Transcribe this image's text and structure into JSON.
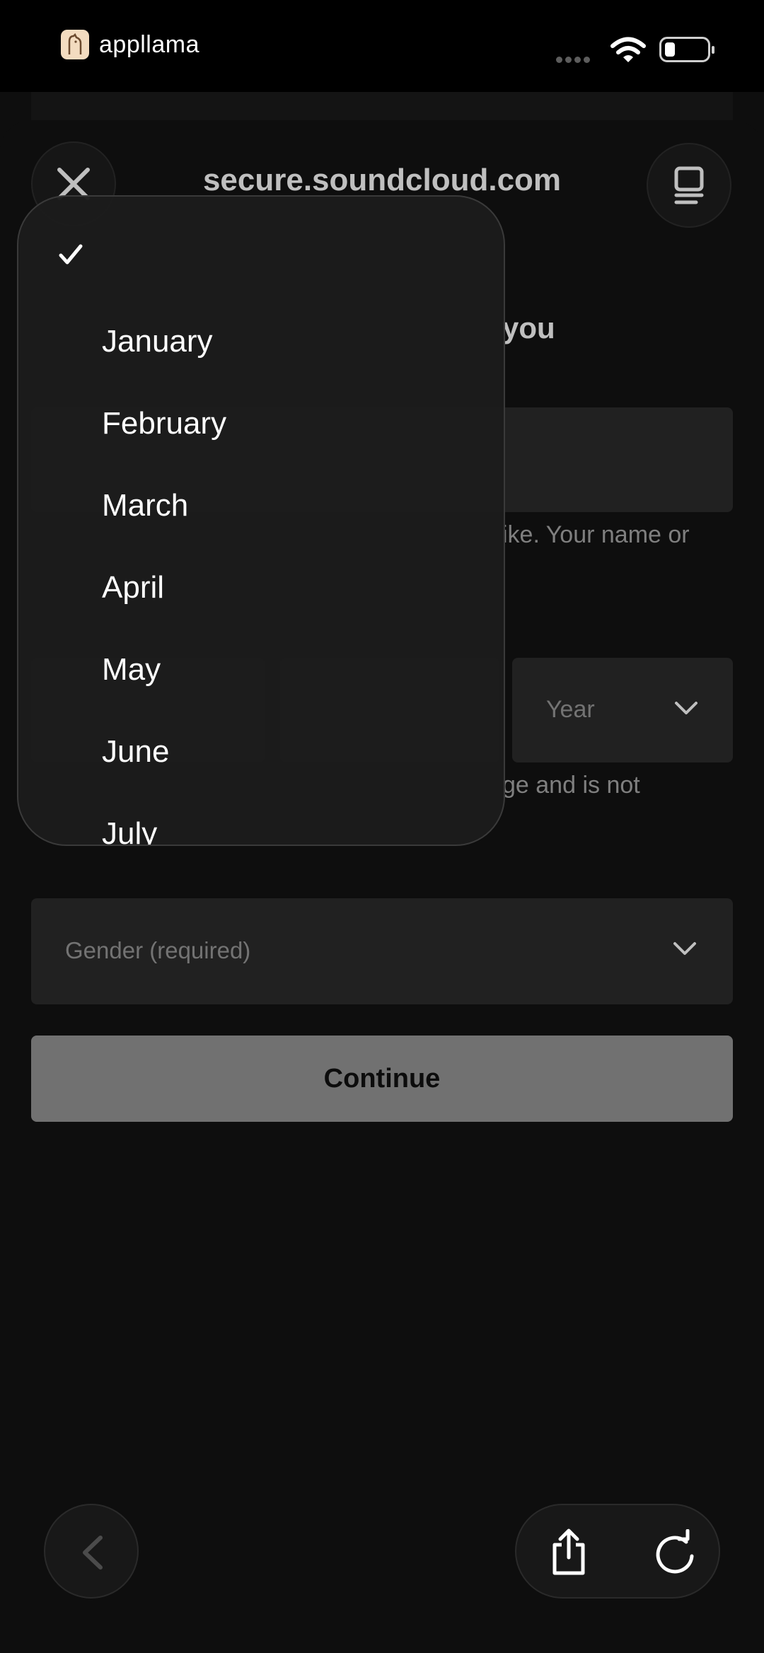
{
  "status_bar": {
    "app_name": "appllama",
    "app_icon": "llama-icon",
    "signal_icon": "signal-dots-icon",
    "wifi_icon": "wifi-icon",
    "battery_icon": "battery-icon"
  },
  "browser": {
    "url_title": "secure.soundcloud.com",
    "close_icon": "close-icon",
    "reader_icon": "reader-mode-icon"
  },
  "form": {
    "heading_visible": "you",
    "name_hint_visible": "ike. Your name or",
    "year_placeholder": "Year",
    "dob_hint_visible": "ge and is not",
    "gender_placeholder": "Gender (required)",
    "continue_label": "Continue"
  },
  "month_dropdown": {
    "selected_mark": "✓",
    "options": [
      "January",
      "February",
      "March",
      "April",
      "May",
      "June",
      "July"
    ]
  },
  "toolbar": {
    "back_icon": "chevron-left-icon",
    "share_icon": "share-icon",
    "reload_icon": "reload-icon"
  },
  "colors": {
    "background": "#131313",
    "field": "#2c2c2c",
    "button_disabled": "#979797"
  }
}
